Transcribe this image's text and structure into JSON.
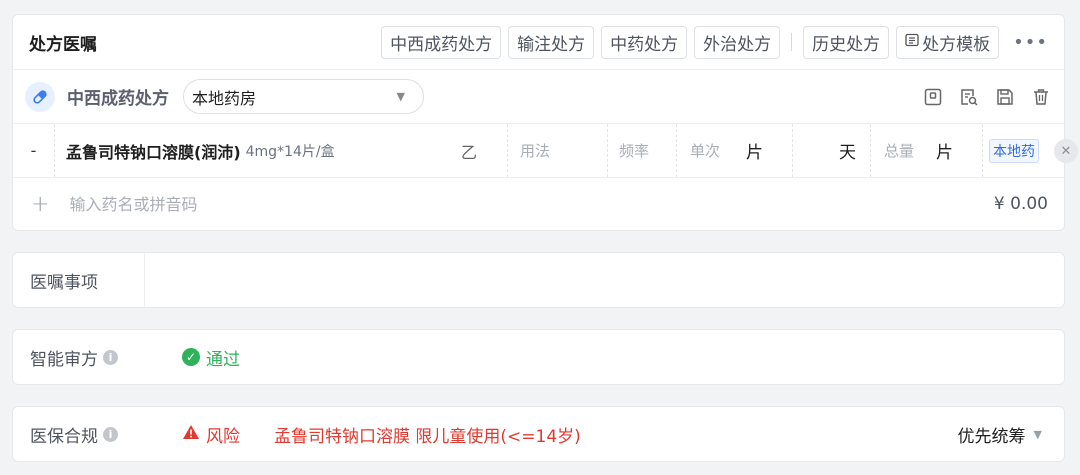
{
  "prescription": {
    "title": "处方医嘱",
    "tabs": [
      "中西成药处方",
      "输注处方",
      "中药处方",
      "外治处方"
    ],
    "history_label": "历史处方",
    "template_label": "处方模板",
    "sub_title": "中西成药处方",
    "pharmacy": "本地药房",
    "drug": {
      "index": "-",
      "name": "孟鲁司特钠口溶膜(润沛)",
      "spec": "4mg*14片/盒",
      "class": "乙",
      "usage_placeholder": "用法",
      "freq_placeholder": "频率",
      "single_placeholder": "单次",
      "single_unit": "片",
      "days_unit": "天",
      "total_placeholder": "总量",
      "total_unit": "片",
      "source": "本地药"
    },
    "add_placeholder": "输入药名或拼音码",
    "total_price": "¥ 0.00"
  },
  "notes": {
    "label": "医嘱事项"
  },
  "audit": {
    "label": "智能审方",
    "result": "通过",
    "color": "#2fb35a"
  },
  "insurance": {
    "label": "医保合规",
    "status": "风险",
    "message": "孟鲁司特钠口溶膜 限儿童使用(<=14岁)",
    "priority": "优先统筹",
    "color": "#e0392f"
  }
}
